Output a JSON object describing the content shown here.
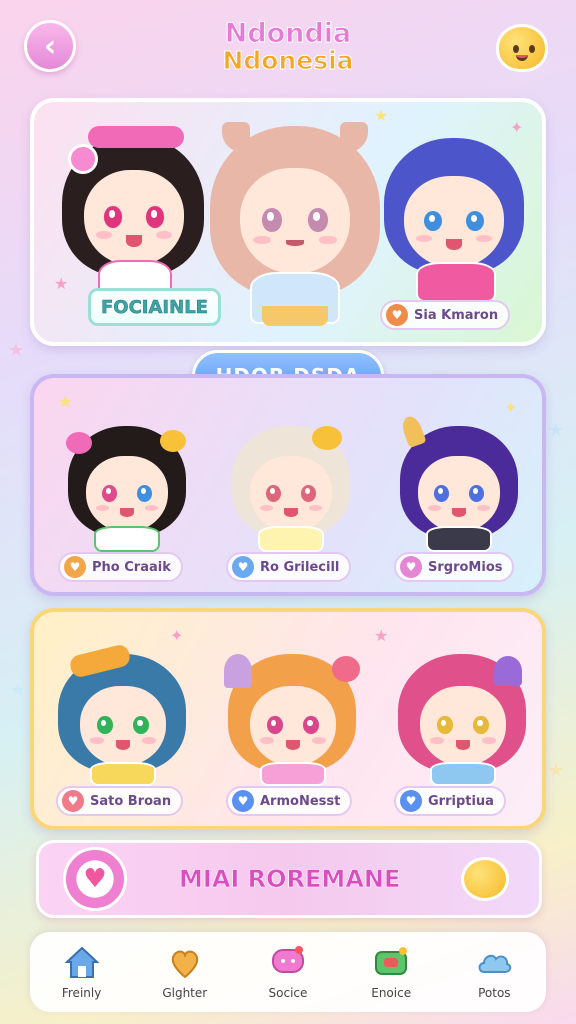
{
  "header": {
    "title_line1": "Ndondia",
    "title_line2": "Ndonesia",
    "back_icon": "chevron-left-icon",
    "mascot_icon": "smiley-mascot-icon"
  },
  "featured": {
    "tag_label": "FOCIAINLE",
    "characters": [
      {
        "name": "",
        "hair": "#2a1e1e",
        "eye": "#e0357d",
        "outfit": "#ffffff",
        "accent": "#f06ab8"
      },
      {
        "name": "",
        "hair": "#e9b7a8",
        "eye": "#c48ab0",
        "outfit": "#cfe6fb",
        "accent": "#f7c86a"
      },
      {
        "name": "Sia Kmaron",
        "hair": "#4c55c9",
        "eye": "#3e8fe0",
        "outfit": "#f05aa0",
        "accent": "#f08c4a"
      }
    ]
  },
  "section_header": "HDOR DSDA",
  "grid_row_1": [
    {
      "name": "Pho Craaik",
      "hair": "#231a1a",
      "eye": "#e04a8a",
      "outfit": "#ffffff",
      "badge": "#f3a54a"
    },
    {
      "name": "Ro Grilecill",
      "hair": "#efe4d8",
      "eye": "#e0657a",
      "outfit": "#fff3b0",
      "badge": "#6aa8f0"
    },
    {
      "name": "SrgroMios",
      "hair": "#4b2a9a",
      "eye": "#4d6fe0",
      "outfit": "#3a3a4a",
      "badge": "#e486d4"
    }
  ],
  "grid_row_2": [
    {
      "name": "Sato Broan",
      "hair": "#3a7aa8",
      "eye": "#2fb45a",
      "outfit": "#f7d85a",
      "badge": "#f07a8a"
    },
    {
      "name": "ArmoNesst",
      "hair": "#f2a04a",
      "eye": "#d9468c",
      "outfit": "#f7a0d8",
      "badge": "#5a90f0"
    },
    {
      "name": "Grriptiua",
      "hair": "#e0508a",
      "eye": "#e8b83a",
      "outfit": "#8ec8f0",
      "badge": "#5a90f0"
    }
  ],
  "banner": {
    "text": "MIAI ROREMANE",
    "badge_icon": "heart-icon"
  },
  "bottom_nav": [
    {
      "label": "Freinly",
      "icon": "home-icon",
      "color": "#6aa8e8"
    },
    {
      "label": "Glghter",
      "icon": "heart-pin-icon",
      "color": "#f3b14a"
    },
    {
      "label": "Socice",
      "icon": "chat-bubble-icon",
      "color": "#f07ad0"
    },
    {
      "label": "Enoice",
      "icon": "gamepad-icon",
      "color": "#5cc46a"
    },
    {
      "label": "Potos",
      "icon": "cloud-icon",
      "color": "#8ec8f0"
    }
  ],
  "colors": {
    "accent_pink": "#e77ad7",
    "accent_blue": "#5c93f2",
    "accent_yellow": "#f5a623"
  }
}
